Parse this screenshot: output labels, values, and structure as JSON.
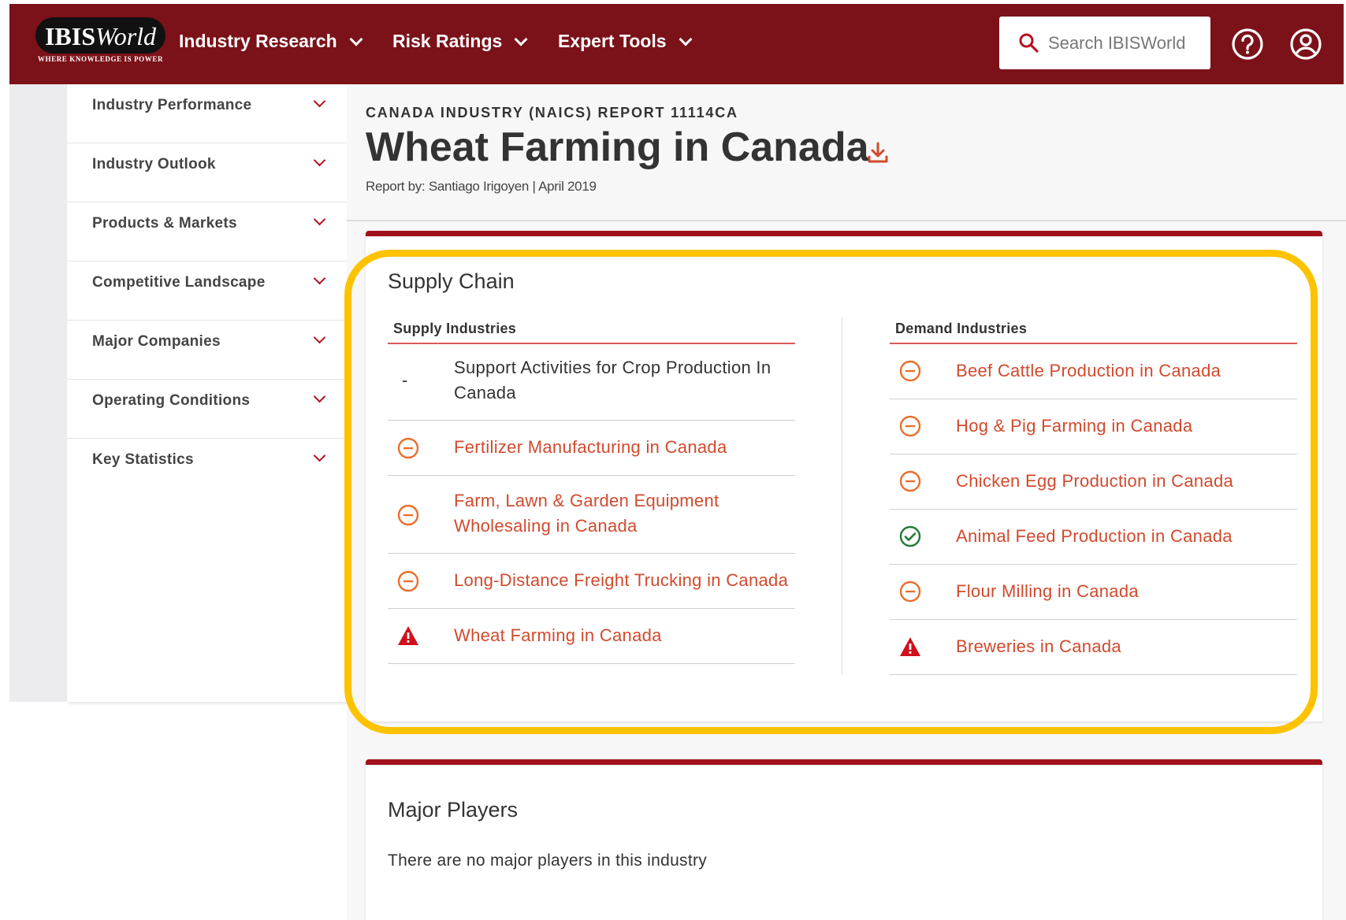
{
  "header": {
    "logo": {
      "brand_bold": "IBIS",
      "brand_italic": "World",
      "tagline": "Where Knowledge is Power"
    },
    "nav": [
      {
        "label": "Industry Research"
      },
      {
        "label": "Risk Ratings"
      },
      {
        "label": "Expert Tools"
      }
    ],
    "search_placeholder": "Search IBISWorld",
    "icons": [
      "help-icon",
      "account-icon"
    ]
  },
  "sidebar": {
    "items": [
      {
        "label": "Industry Performance"
      },
      {
        "label": "Industry Outlook"
      },
      {
        "label": "Products & Markets"
      },
      {
        "label": "Competitive Landscape"
      },
      {
        "label": "Major Companies"
      },
      {
        "label": "Operating Conditions"
      },
      {
        "label": "Key Statistics"
      }
    ]
  },
  "report": {
    "code": "CANADA INDUSTRY (NAICS) REPORT 11114CA",
    "title": "Wheat Farming in Canada",
    "byline": "Report by: Santiago Irigoyen  | April 2019"
  },
  "supply_chain": {
    "title": "Supply Chain",
    "supply_heading": "Supply Industries",
    "demand_heading": "Demand Industries",
    "supply": [
      {
        "line1": "Support Activities for Crop Production In",
        "line2": "Canada",
        "status": "none",
        "link": false
      },
      {
        "line1": "Fertilizer Manufacturing in Canada",
        "line2": "",
        "status": "neutral",
        "link": true
      },
      {
        "line1": "Farm, Lawn & Garden Equipment",
        "line2": "Wholesaling in Canada",
        "status": "neutral",
        "link": true
      },
      {
        "line1": "Long-Distance Freight Trucking in Canada",
        "line2": "",
        "status": "neutral",
        "link": true
      },
      {
        "line1": "Wheat Farming in Canada",
        "line2": "",
        "status": "warning",
        "link": true
      }
    ],
    "demand": [
      {
        "line1": "Beef Cattle Production in Canada",
        "status": "neutral"
      },
      {
        "line1": "Hog & Pig Farming in Canada",
        "status": "neutral"
      },
      {
        "line1": "Chicken Egg Production in Canada",
        "status": "neutral"
      },
      {
        "line1": "Animal Feed Production in Canada",
        "status": "positive"
      },
      {
        "line1": "Flour Milling in Canada",
        "status": "neutral"
      },
      {
        "line1": "Breweries in Canada",
        "status": "warning"
      }
    ],
    "dash_symbol": "-"
  },
  "major_players": {
    "title": "Major Players",
    "text": "There are no major players in this industry"
  },
  "colors": {
    "header_bg": "#7b1219",
    "accent_red": "#a0121c",
    "link": "#d14a2d",
    "neutral_icon": "#ea6e2c",
    "positive_icon": "#1f7a35",
    "warning_icon": "#d0101c",
    "highlight": "#fdc300"
  }
}
